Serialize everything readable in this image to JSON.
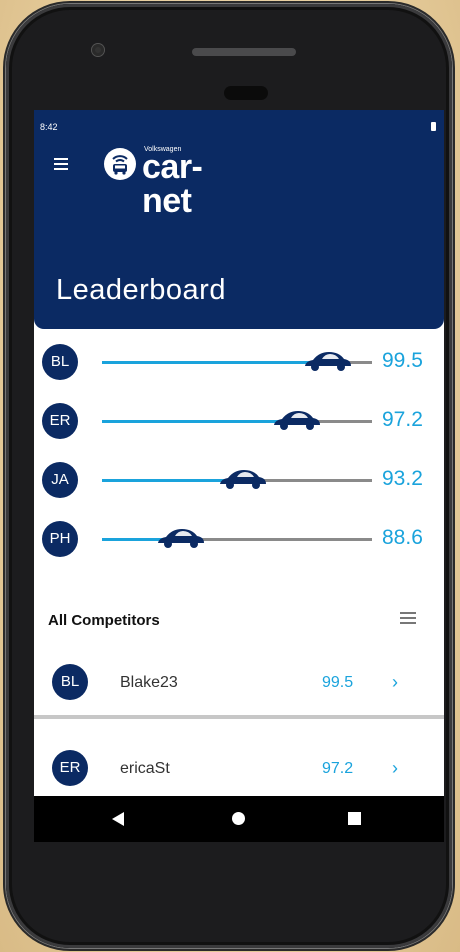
{
  "status_bar": {
    "time": "8:42"
  },
  "header": {
    "brand_small": "Volkswagen",
    "brand_name": "car-net",
    "title": "Leaderboard"
  },
  "leaderboard": [
    {
      "initials": "BL",
      "score": "99.5",
      "progress": 0.995
    },
    {
      "initials": "ER",
      "score": "97.2",
      "progress": 0.972
    },
    {
      "initials": "JA",
      "score": "93.2",
      "progress": 0.932
    },
    {
      "initials": "PH",
      "score": "88.6",
      "progress": 0.886
    }
  ],
  "competitors": {
    "title": "All Competitors",
    "items": [
      {
        "initials": "BL",
        "name": "Blake23",
        "score": "99.5",
        "chevron": "›"
      },
      {
        "initials": "ER",
        "name": "ericaSt",
        "score": "97.2",
        "chevron": "›"
      }
    ]
  },
  "icons": {
    "menu": "hamburger-icon",
    "logo": "car-net-logo-icon",
    "car": "vw-beetle-car-icon",
    "filter": "sort-filter-icon",
    "back": "back-triangle-icon",
    "home": "home-circle-icon",
    "recents": "recents-square-icon"
  },
  "colors": {
    "header_bg": "#0b2a63",
    "accent": "#1aa3dc",
    "track": "#8a8a8a"
  }
}
